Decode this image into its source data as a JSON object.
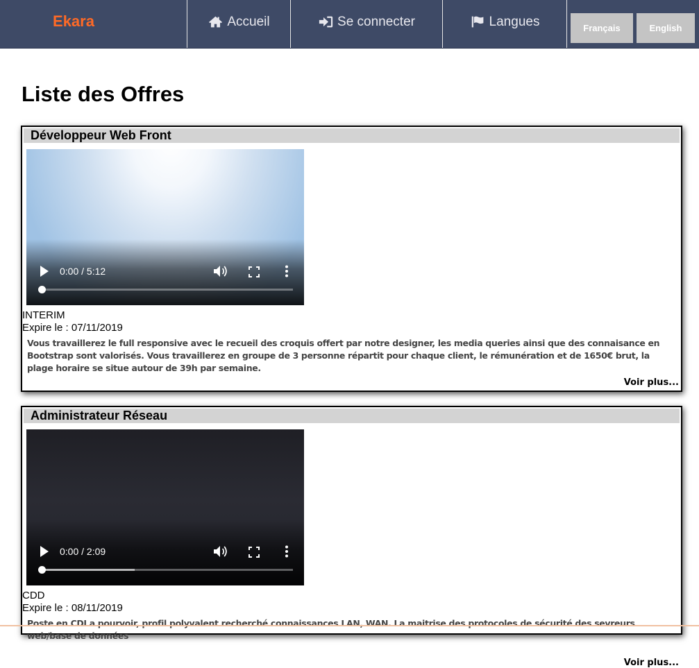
{
  "navbar": {
    "brand": "Ekara",
    "items": [
      {
        "label": "Accueil",
        "icon": "home-icon"
      },
      {
        "label": "Se connecter",
        "icon": "sign-in-icon"
      },
      {
        "label": "Langues",
        "icon": "flag-icon"
      }
    ],
    "languages": [
      "Français",
      "English"
    ]
  },
  "page": {
    "title": "Liste des Offres"
  },
  "offers": [
    {
      "title": "Développeur Web Front",
      "video_time": "0:00 / 5:12",
      "video_played": 0,
      "type": "INTERIM",
      "expires": "Expire le : 07/11/2019",
      "description": "Vous travaillerez le full responsive avec le recueil des croquis offert par notre designer, les media queries ainsi que des connaisance en Bootstrap sont valorisés. Vous travaillerez en groupe de 3 personne répartit pour chaque client, le rémunération et de 1650€ brut, la plage horaire se situe autour de 39h par semaine.",
      "more": "Voir plus..."
    },
    {
      "title": "Administrateur Réseau",
      "video_time": "0:00 / 2:09",
      "video_played": 0,
      "video_buffered": 0.37,
      "type": "CDD",
      "expires": "Expire le : 08/11/2019",
      "description": "Poste en CDI a pourvoir, profil polyvalent recherché connaissances LAN, WAN. La maitrise des protocoles de sécurité des sevreurs web/base de données",
      "more": "Voir plus..."
    }
  ],
  "colors": {
    "navbar": "#3e4a66",
    "brand": "#ff6a26",
    "header_band": "#d3d3d3",
    "lang_button": "#c4c4c4"
  }
}
